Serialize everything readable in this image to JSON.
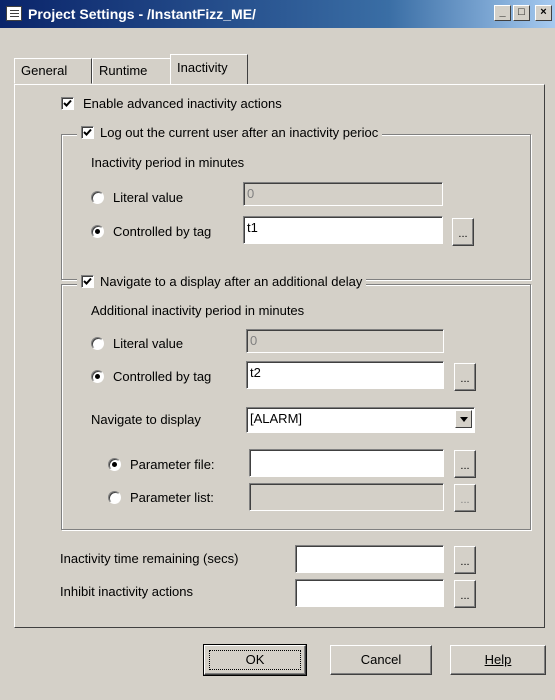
{
  "window": {
    "title": "Project Settings - /InstantFizz_ME/",
    "controls": {
      "minimize": "_",
      "maximize": "□",
      "close": "×"
    }
  },
  "tabs": [
    {
      "label": "General",
      "active": false
    },
    {
      "label": "Runtime",
      "active": false
    },
    {
      "label": "Inactivity",
      "active": true
    }
  ],
  "enable_advanced": {
    "label": "Enable advanced inactivity actions",
    "checked": true
  },
  "logout_group": {
    "legend": "Log out the current user after an inactivity perioc",
    "checked": true,
    "period_label": "Inactivity period in minutes",
    "literal_label": "Literal value",
    "literal_value": "0",
    "tag_label": "Controlled by tag",
    "tag_value": "t1",
    "selected": "tag"
  },
  "navigate_group": {
    "legend": "Navigate to a display after an additional delay",
    "checked": true,
    "period_label": "Additional inactivity period in minutes",
    "literal_label": "Literal value",
    "literal_value": "0",
    "tag_label": "Controlled by tag",
    "tag_value": "t2",
    "selected": "tag",
    "display_label": "Navigate to display",
    "display_value": "[ALARM]",
    "param_file_label": "Parameter file:",
    "param_file_value": "",
    "param_list_label": "Parameter list:",
    "param_list_value": "",
    "param_selected": "file"
  },
  "remaining_label": "Inactivity time remaining (secs)",
  "remaining_value": "",
  "inhibit_label": "Inhibit inactivity actions",
  "inhibit_value": "",
  "browse_label": "...",
  "buttons": {
    "ok": "OK",
    "cancel": "Cancel",
    "help": "Help"
  },
  "colors": {
    "face": "#d4d0c8",
    "title_start": "#0a246a",
    "title_end": "#a6caf0"
  }
}
